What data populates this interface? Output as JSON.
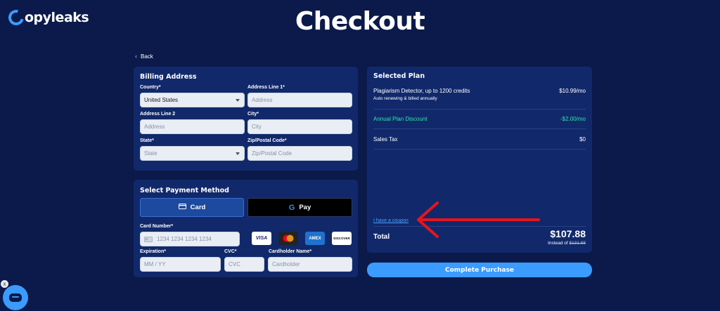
{
  "brand": {
    "name": "Copyleaks",
    "name_rest": "opyleaks"
  },
  "page": {
    "title": "Checkout",
    "back_label": "Back"
  },
  "billing": {
    "title": "Billing Address",
    "country": {
      "label": "Country*",
      "value": "United States"
    },
    "address1": {
      "label": "Address Line 1*",
      "placeholder": "Address"
    },
    "address2": {
      "label": "Address Line 2",
      "placeholder": "Address"
    },
    "city": {
      "label": "City*",
      "placeholder": "City"
    },
    "state": {
      "label": "State*",
      "placeholder": "State"
    },
    "zip": {
      "label": "Zip/Postal Code*",
      "placeholder": "Zip/Postal Code"
    }
  },
  "payment": {
    "title": "Select Payment Method",
    "card_button": "Card",
    "gpay_button": "Pay",
    "card_number": {
      "label": "Card Number*",
      "placeholder": "1234 1234 1234 1234"
    },
    "expiration": {
      "label": "Expiration*",
      "placeholder": "MM / YY"
    },
    "cvc": {
      "label": "CVC*",
      "placeholder": "CVC"
    },
    "holder": {
      "label": "Cardholder Name*",
      "placeholder": "Cardholder"
    },
    "card_brands": [
      "VISA",
      "MC",
      "AMEX",
      "DISCOVER"
    ]
  },
  "plan": {
    "title": "Selected Plan",
    "item_name": "Plagiarism Detector, up to 1200 credits",
    "item_note": "Auto renewing & billed annually",
    "item_price": "$10.99/mo",
    "discount_label": "Annual Plan Discount",
    "discount_value": "-$2.00/mo",
    "tax_label": "Sales Tax",
    "tax_value": "$0",
    "coupon_link": "I have a coupon",
    "total_label": "Total",
    "total_value": "$107.88",
    "instead_of_label": "Instead of",
    "instead_of_value": "$131.88"
  },
  "actions": {
    "complete_purchase": "Complete Purchase",
    "chat_close": "x"
  },
  "colors": {
    "background": "#0b1a4a",
    "panel": "#11296b",
    "accent": "#3b9bff",
    "discount": "#2ee6a8",
    "annotation_arrow": "#e8141c"
  }
}
